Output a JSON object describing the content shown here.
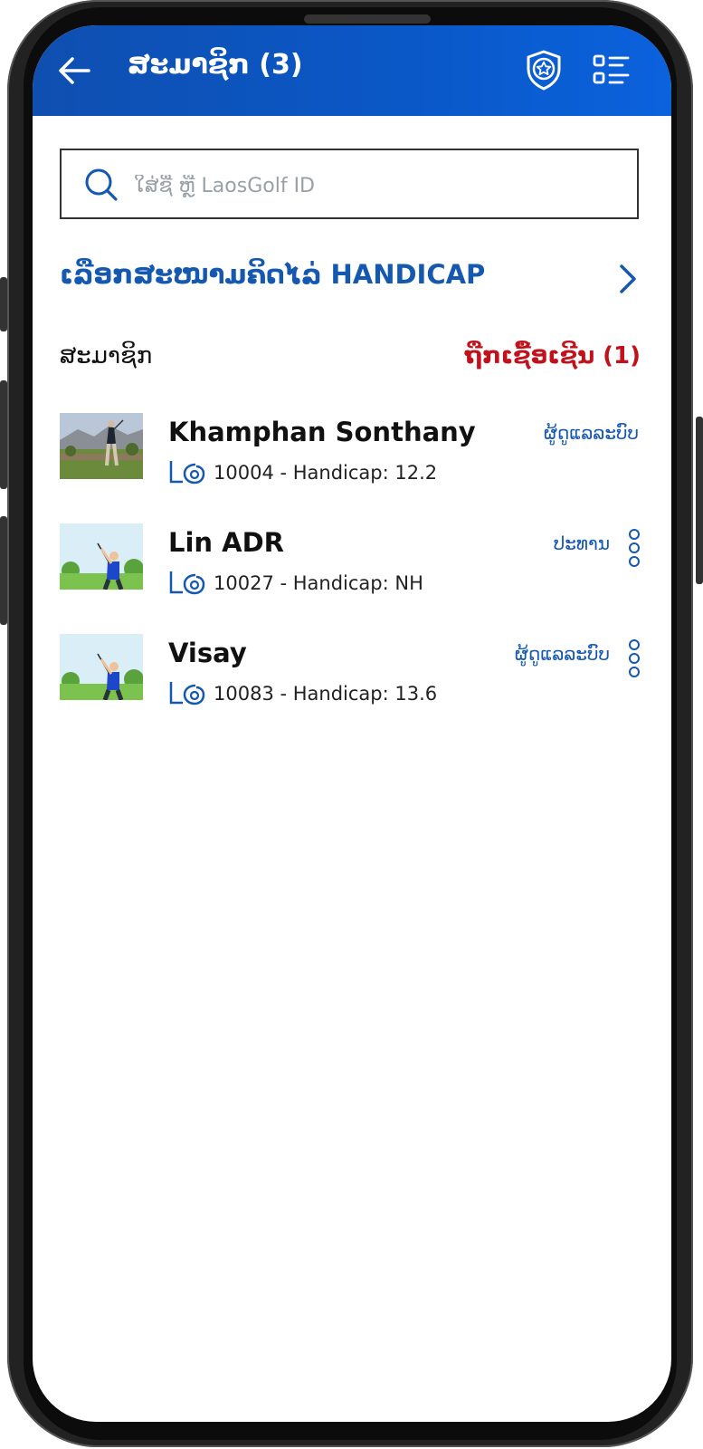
{
  "header": {
    "title": "ສະມາຊິກ (3)",
    "back_icon": "arrow-left-icon",
    "badge_icon": "shield-star-icon",
    "menu_icon": "list-icon"
  },
  "search": {
    "placeholder": "ໃສ່ຊື່ ຫຼື LaosGolf ID",
    "icon": "search-icon"
  },
  "handicap_select": {
    "label": "ເລືອກສະໜາມຄິດໄລ່ HANDICAP",
    "icon": "chevron-right-icon"
  },
  "section": {
    "members_label": "ສະມາຊິກ",
    "invited_label": "ຖືກເຊື້ອເຊີນ (1)"
  },
  "members": [
    {
      "name": "Khamphan Sonthany",
      "info": "10004 - Handicap: 12.2",
      "role": "ຜູ້ດູແລລະບົບ",
      "has_menu": false
    },
    {
      "name": "Lin ADR",
      "info": "10027 - Handicap: NH",
      "role": "ປະທານ",
      "has_menu": true
    },
    {
      "name": "Visay",
      "info": "10083 - Handicap: 13.6",
      "role": "ຜູ້ດູແລລະບົບ",
      "has_menu": true
    }
  ],
  "colors": {
    "header_blue": "#0a58c8",
    "link_blue": "#1558b0",
    "invite_red": "#c1121b"
  }
}
